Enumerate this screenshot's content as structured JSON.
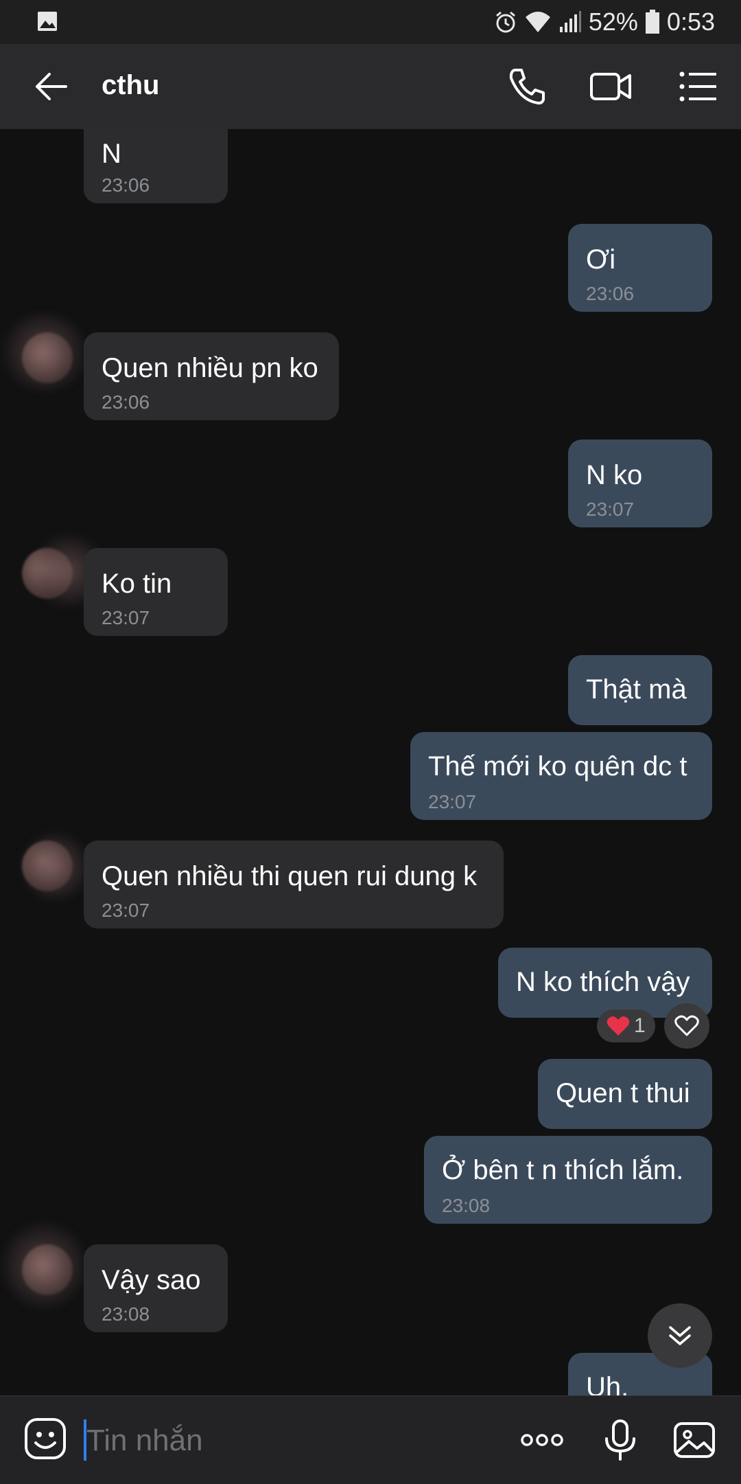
{
  "status_bar": {
    "battery": "52%",
    "time": "0:53"
  },
  "header": {
    "back_icon": "arrow-left-icon",
    "title": "cthu",
    "call_icon": "phone-icon",
    "video_icon": "video-camera-icon",
    "menu_icon": "menu-list-icon"
  },
  "messages": [
    {
      "dir": "in",
      "text": "N",
      "time": "23:06"
    },
    {
      "dir": "out",
      "text": "Ơi",
      "time": "23:06"
    },
    {
      "dir": "in",
      "text": "Quen nhiều pn ko",
      "time": "23:06"
    },
    {
      "dir": "out",
      "text": "N ko",
      "time": "23:07"
    },
    {
      "dir": "in",
      "text": "Ko tin",
      "time": "23:07"
    },
    {
      "dir": "out",
      "text": "Thật mà",
      "time": ""
    },
    {
      "dir": "out",
      "text": "Thế mới ko quên dc t",
      "time": "23:07"
    },
    {
      "dir": "in",
      "text": "Quen nhiều thi quen rui dung k",
      "time": "23:07"
    },
    {
      "dir": "out",
      "text": "N ko thích vậy",
      "time": "",
      "reaction": {
        "emoji": "heart",
        "count": "1"
      }
    },
    {
      "dir": "out",
      "text": "Quen t thui",
      "time": ""
    },
    {
      "dir": "out",
      "text": "Ở bên t n thích lắm.",
      "time": "23:08"
    },
    {
      "dir": "in",
      "text": "Vậy sao",
      "time": "23:08"
    },
    {
      "dir": "out",
      "text": "Uh.",
      "time": ""
    }
  ],
  "composer": {
    "placeholder": "Tin nhắn",
    "emoji_icon": "emoji-icon",
    "more_icon": "more-dots-icon",
    "mic_icon": "microphone-icon",
    "image_icon": "image-icon"
  },
  "colors": {
    "background": "#111112",
    "incoming_bubble": "#2c2c2e",
    "outgoing_bubble": "#3b4a5b",
    "accent": "#2f7ff0"
  }
}
